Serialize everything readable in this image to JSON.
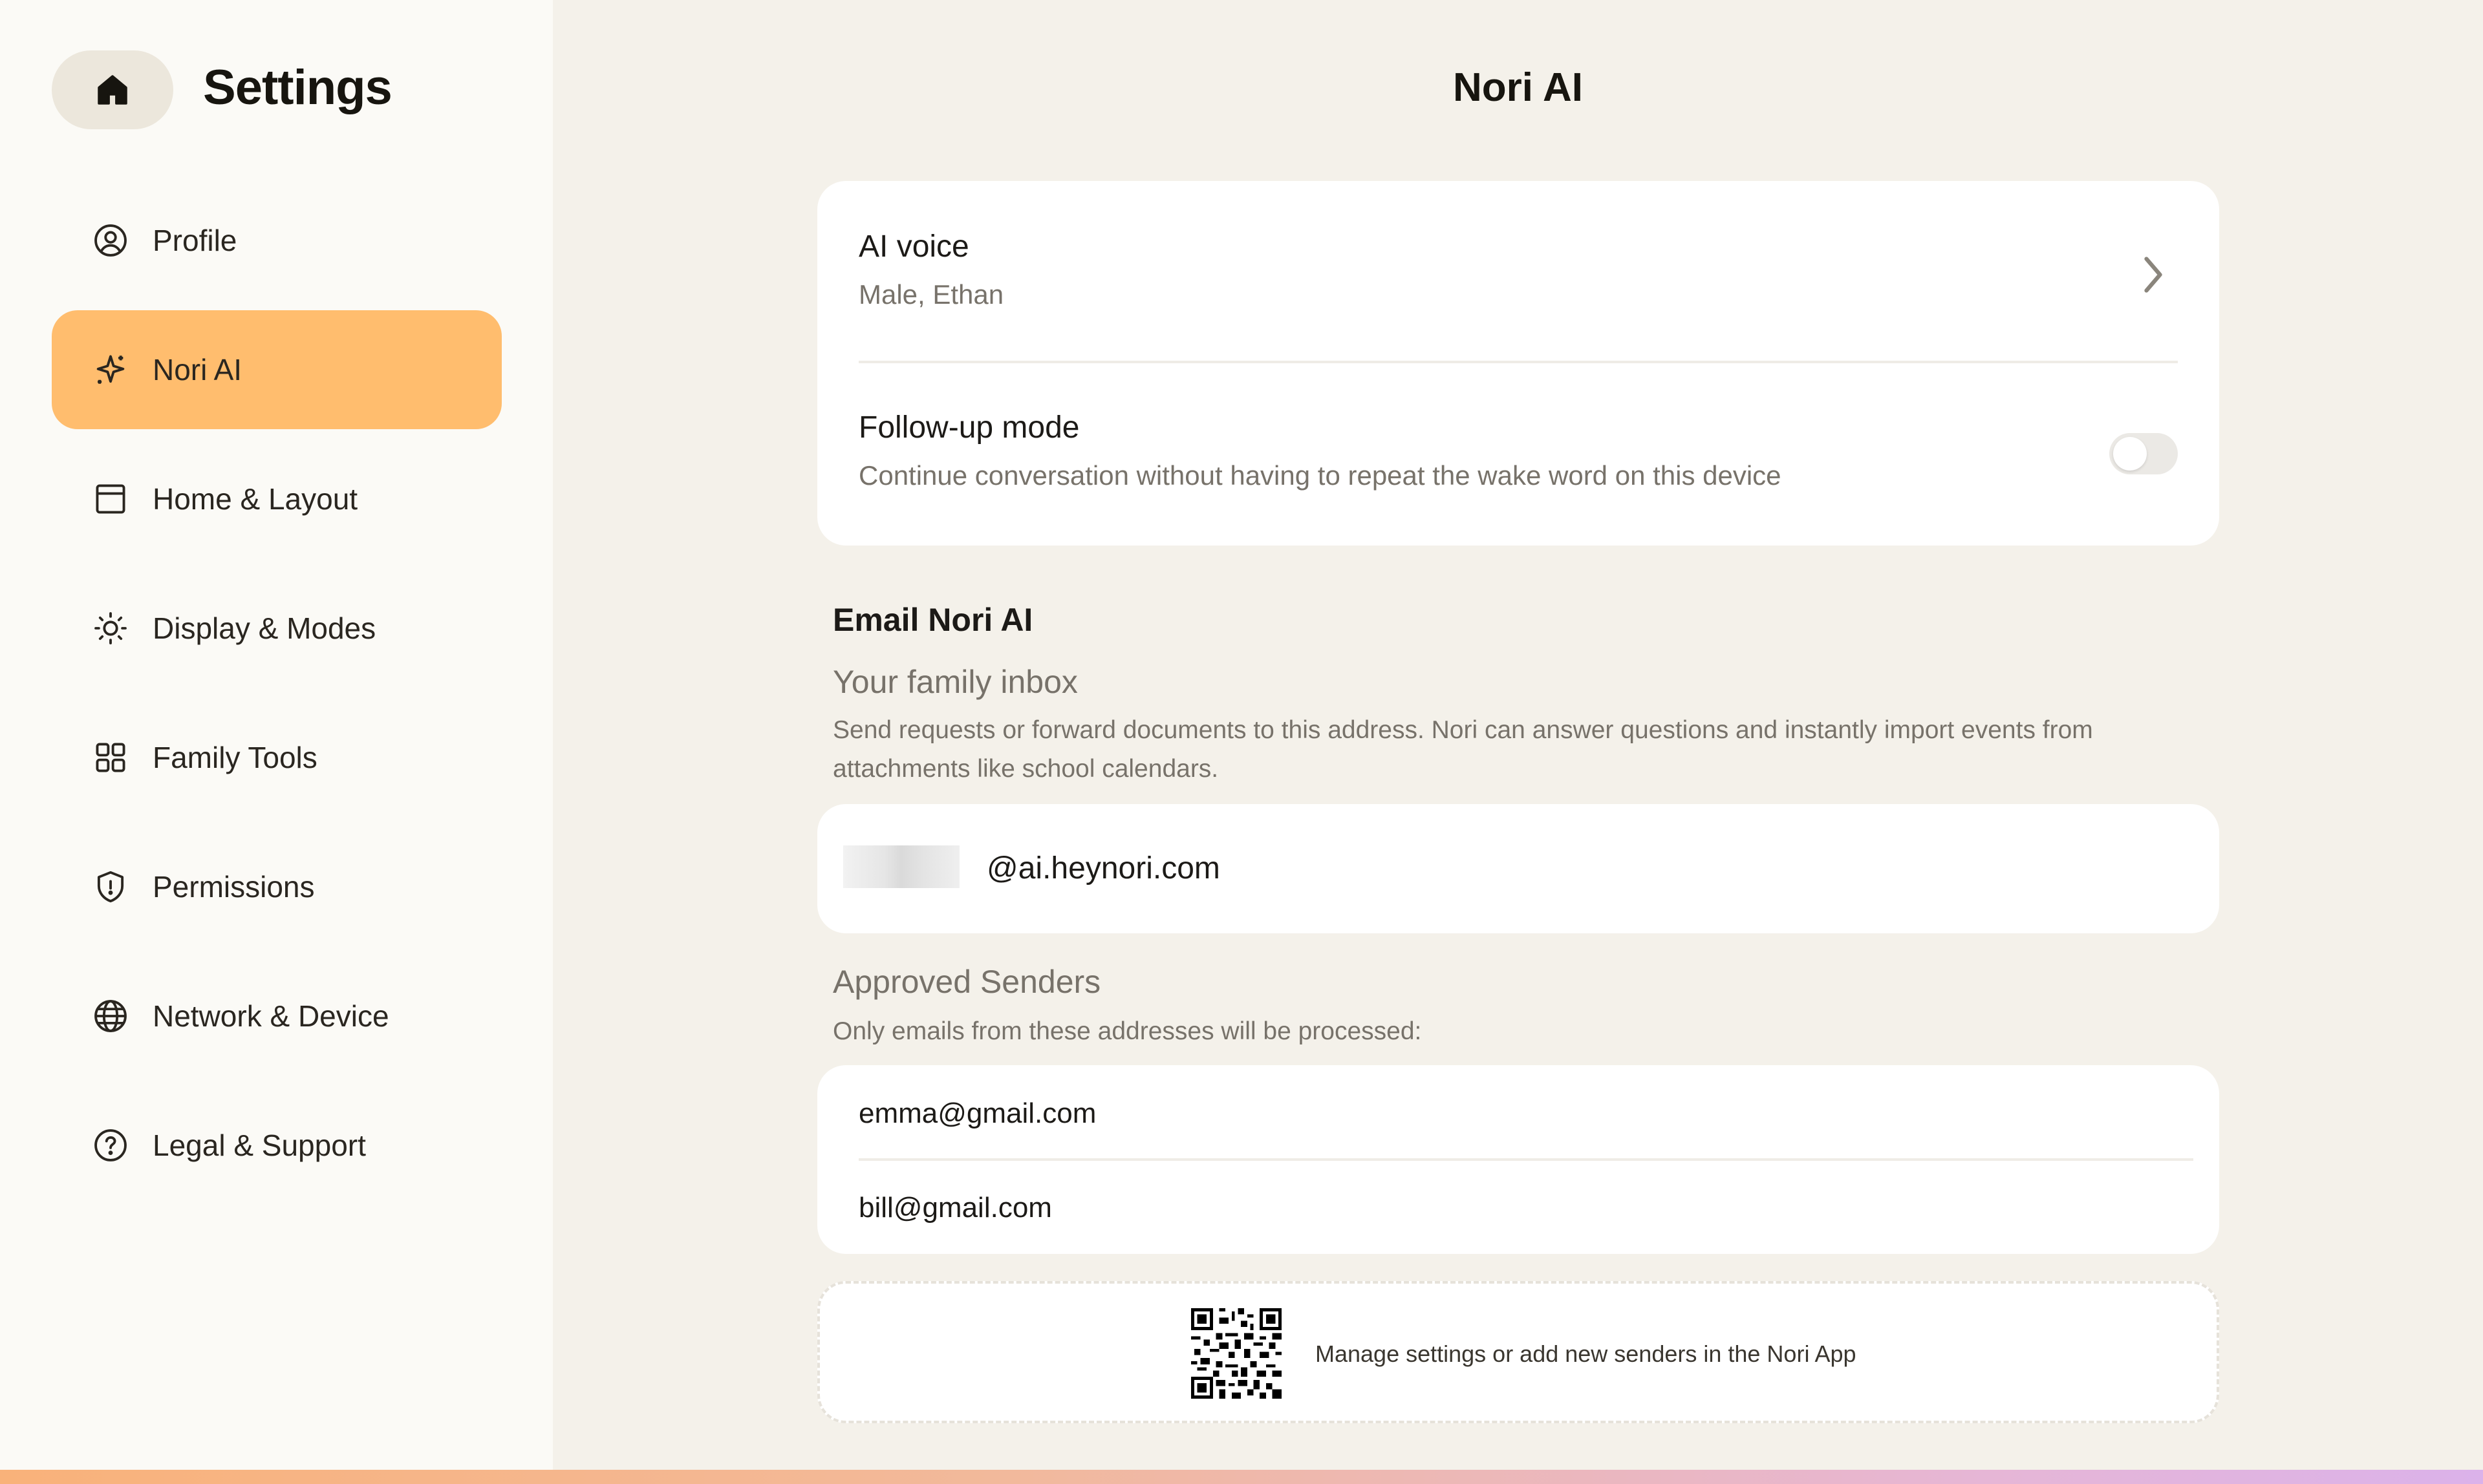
{
  "sidebar": {
    "title": "Settings",
    "home_icon": "home-icon",
    "items": [
      {
        "label": "Profile",
        "icon": "user-circle-icon",
        "active": false
      },
      {
        "label": "Nori AI",
        "icon": "sparkle-icon",
        "active": true
      },
      {
        "label": "Home & Layout",
        "icon": "layout-icon",
        "active": false
      },
      {
        "label": "Display & Modes",
        "icon": "sun-icon",
        "active": false
      },
      {
        "label": "Family Tools",
        "icon": "grid-icon",
        "active": false
      },
      {
        "label": "Permissions",
        "icon": "shield-icon",
        "active": false
      },
      {
        "label": "Network & Device",
        "icon": "globe-icon",
        "active": false
      },
      {
        "label": "Legal & Support",
        "icon": "help-circle-icon",
        "active": false
      }
    ],
    "active_color": "#ffbd6e"
  },
  "main": {
    "title": "Nori AI",
    "ai_voice": {
      "label": "AI voice",
      "value": "Male, Ethan"
    },
    "follow_up": {
      "label": "Follow-up mode",
      "description": "Continue conversation without having to repeat the wake word on this device",
      "enabled": false
    },
    "email_section": {
      "title": "Email Nori AI",
      "inbox_heading": "Your family inbox",
      "inbox_description": "Send requests or forward documents to this address. Nori can answer questions and instantly import events from attachments like school calendars.",
      "email_domain": "@ai.heynori.com",
      "approved_heading": "Approved Senders",
      "approved_description": "Only emails from these addresses will be processed:",
      "senders": [
        "emma@gmail.com",
        "bill@gmail.com"
      ],
      "qr_text": "Manage settings or add new senders in the Nori App"
    }
  },
  "colors": {
    "background": "#f4f1ea",
    "sidebar": "#fbfaf6",
    "card": "#ffffff"
  }
}
